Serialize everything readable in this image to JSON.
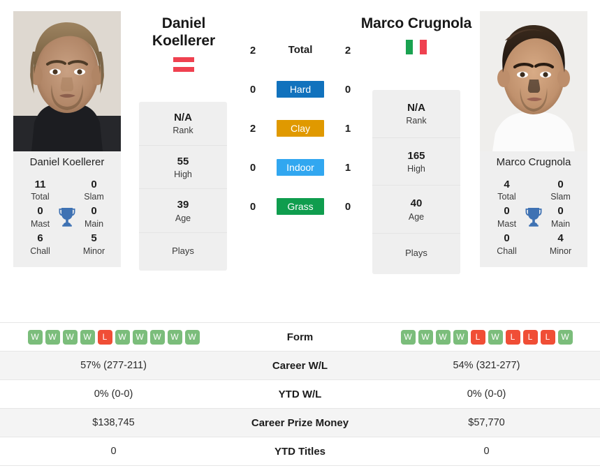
{
  "players": {
    "left": {
      "first_name": "Daniel",
      "last_name": "Koellerer",
      "name": "Daniel Koellerer",
      "country": "Austria",
      "flag_icon": "austria-flag-icon",
      "titles": {
        "total": "11",
        "total_label": "Total",
        "slam": "0",
        "slam_label": "Slam",
        "mast": "0",
        "mast_label": "Mast",
        "main": "0",
        "main_label": "Main",
        "chall": "6",
        "chall_label": "Chall",
        "minor": "5",
        "minor_label": "Minor"
      },
      "card": {
        "rank": "N/A",
        "rank_label": "Rank",
        "high": "55",
        "high_label": "High",
        "age": "39",
        "age_label": "Age",
        "plays": "Plays"
      },
      "h2h": {
        "total": "2",
        "hard": "0",
        "clay": "2",
        "indoor": "0",
        "grass": "0"
      },
      "form": [
        "W",
        "W",
        "W",
        "W",
        "L",
        "W",
        "W",
        "W",
        "W",
        "W"
      ],
      "career_wl": "57% (277-211)",
      "ytd_wl": "0% (0-0)",
      "career_prize_money": "$138,745",
      "ytd_titles": "0"
    },
    "right": {
      "first_name": "Marco",
      "last_name": "Crugnola",
      "name": "Marco Crugnola",
      "country": "Italy",
      "flag_icon": "italy-flag-icon",
      "titles": {
        "total": "4",
        "total_label": "Total",
        "slam": "0",
        "slam_label": "Slam",
        "mast": "0",
        "mast_label": "Mast",
        "main": "0",
        "main_label": "Main",
        "chall": "0",
        "chall_label": "Chall",
        "minor": "4",
        "minor_label": "Minor"
      },
      "card": {
        "rank": "N/A",
        "rank_label": "Rank",
        "high": "165",
        "high_label": "High",
        "age": "40",
        "age_label": "Age",
        "plays": "Plays"
      },
      "h2h": {
        "total": "2",
        "hard": "0",
        "clay": "1",
        "indoor": "1",
        "grass": "0"
      },
      "form": [
        "W",
        "W",
        "W",
        "W",
        "L",
        "W",
        "L",
        "L",
        "L",
        "W"
      ],
      "career_wl": "54% (321-277)",
      "ytd_wl": "0% (0-0)",
      "career_prize_money": "$57,770",
      "ytd_titles": "0"
    }
  },
  "h2h_rows": {
    "total_label": "Total",
    "hard_label": "Hard",
    "clay_label": "Clay",
    "indoor_label": "Indoor",
    "grass_label": "Grass"
  },
  "surface_colors": {
    "hard": "#1172bd",
    "clay": "#e09900",
    "indoor": "#31a7f0",
    "grass": "#0f9d4e"
  },
  "form_colors": {
    "win": "#7bbd7b",
    "loss": "#f04e36"
  },
  "table_labels": {
    "form": "Form",
    "career_wl": "Career W/L",
    "ytd_wl": "YTD W/L",
    "career_prize_money": "Career Prize Money",
    "ytd_titles": "YTD Titles"
  },
  "icons": {
    "trophy": "trophy-icon"
  }
}
